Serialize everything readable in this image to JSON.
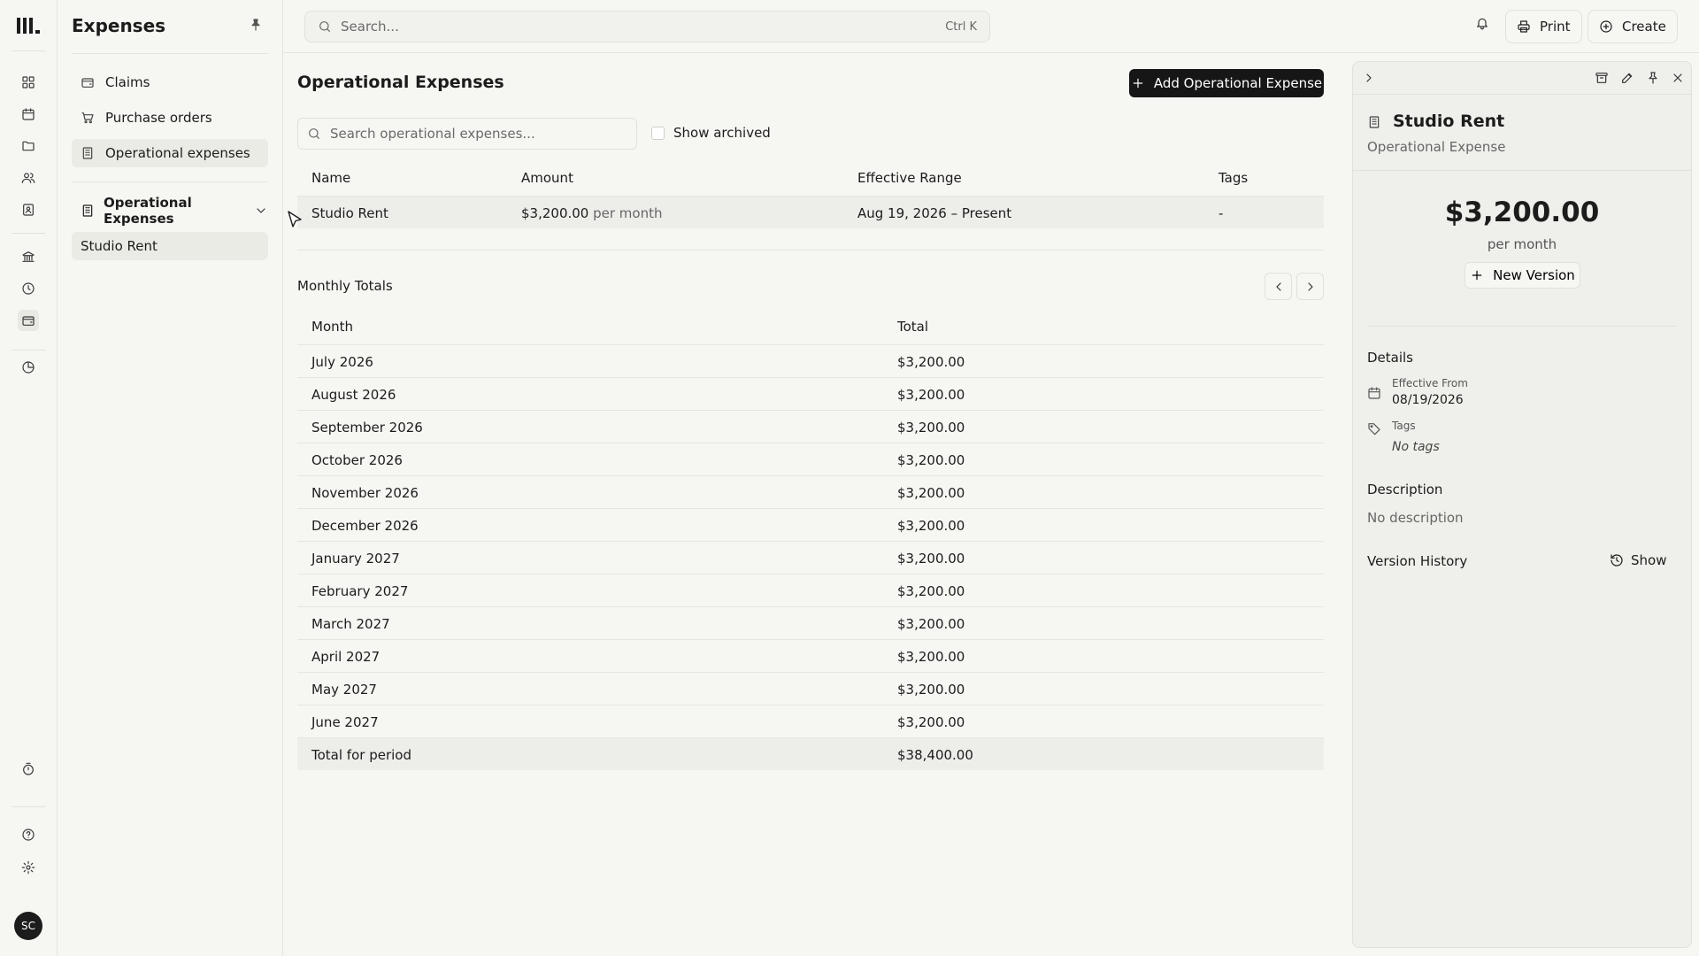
{
  "app": {
    "section_title": "Expenses",
    "user_initials": "SC"
  },
  "sidebar": {
    "items": [
      {
        "label": "Claims",
        "icon": "wallet-icon"
      },
      {
        "label": "Purchase orders",
        "icon": "cart-icon"
      },
      {
        "label": "Operational expenses",
        "icon": "building-icon"
      }
    ],
    "group": {
      "label": "Operational Expenses",
      "icon": "building-icon"
    },
    "sub_items": [
      {
        "label": "Studio Rent"
      }
    ]
  },
  "topbar": {
    "search_placeholder": "Search...",
    "shortcut": "Ctrl K",
    "print_label": "Print",
    "create_label": "Create"
  },
  "main": {
    "title": "Operational Expenses",
    "add_button_label": "Add Operational Expense",
    "search_placeholder": "Search operational expenses...",
    "show_archived_label": "Show archived",
    "columns": {
      "name": "Name",
      "amount": "Amount",
      "range": "Effective Range",
      "tags": "Tags"
    },
    "rows": [
      {
        "name": "Studio Rent",
        "amount": "$3,200.00",
        "period": "per month",
        "range": "Aug 19, 2026 – Present",
        "tags": "-"
      }
    ],
    "monthly": {
      "title": "Monthly Totals",
      "columns": {
        "month": "Month",
        "total": "Total"
      },
      "rows": [
        {
          "month": "July 2026",
          "total": "$3,200.00"
        },
        {
          "month": "August 2026",
          "total": "$3,200.00"
        },
        {
          "month": "September 2026",
          "total": "$3,200.00"
        },
        {
          "month": "October 2026",
          "total": "$3,200.00"
        },
        {
          "month": "November 2026",
          "total": "$3,200.00"
        },
        {
          "month": "December 2026",
          "total": "$3,200.00"
        },
        {
          "month": "January 2027",
          "total": "$3,200.00"
        },
        {
          "month": "February 2027",
          "total": "$3,200.00"
        },
        {
          "month": "March 2027",
          "total": "$3,200.00"
        },
        {
          "month": "April 2027",
          "total": "$3,200.00"
        },
        {
          "month": "May 2027",
          "total": "$3,200.00"
        },
        {
          "month": "June 2027",
          "total": "$3,200.00"
        }
      ],
      "total_label": "Total for period",
      "total_value": "$38,400.00"
    }
  },
  "detail": {
    "title": "Studio Rent",
    "subtitle": "Operational Expense",
    "amount": "$3,200.00",
    "period": "per month",
    "new_version_label": "New Version",
    "details_heading": "Details",
    "effective_from_label": "Effective From",
    "effective_from_value": "08/19/2026",
    "tags_label": "Tags",
    "tags_value": "No tags",
    "description_heading": "Description",
    "description_value": "No description",
    "version_history_label": "Version History",
    "show_label": "Show"
  },
  "colors": {
    "background": "#f6f6f3",
    "primary_button": "#161616",
    "panel": "#efefeb"
  }
}
